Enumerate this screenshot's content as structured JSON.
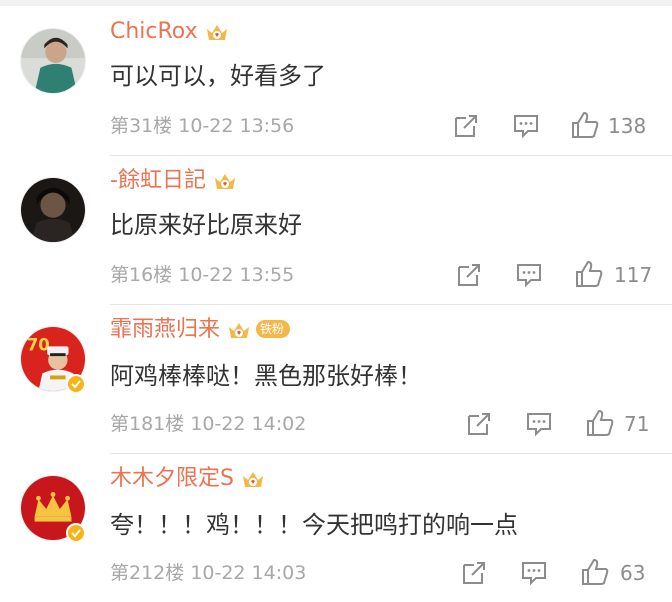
{
  "comments": [
    {
      "username": "ChicRox",
      "text": "可以可以，好看多了",
      "floor": "第31楼",
      "time": "10-22 13:56",
      "likes": "138",
      "badge": "",
      "verified": false,
      "avatar": "avatar-person-green-coat"
    },
    {
      "username": "-餘虹日記",
      "text": "比原来好比原来好",
      "floor": "第16楼",
      "time": "10-22 13:55",
      "likes": "117",
      "badge": "",
      "verified": false,
      "avatar": "avatar-dark-portrait"
    },
    {
      "username": "霏雨燕归来",
      "text": "阿鸡棒棒哒！黑色那张好棒！",
      "floor": "第181楼",
      "time": "10-22 14:02",
      "likes": "71",
      "badge": "铁粉",
      "verified": true,
      "avatar": "avatar-soldier-red-70"
    },
    {
      "username": "木木夕限定S",
      "text": "夸！！！鸡！！！今天把鸣打的响一点",
      "floor": "第212楼",
      "time": "10-22 14:03",
      "likes": "63",
      "badge": "",
      "verified": true,
      "avatar": "avatar-crown-red"
    }
  ],
  "colors": {
    "username": "#eb7350",
    "text": "#333333",
    "meta": "#a8a8a8",
    "vip_gold": "#f4b84a"
  }
}
